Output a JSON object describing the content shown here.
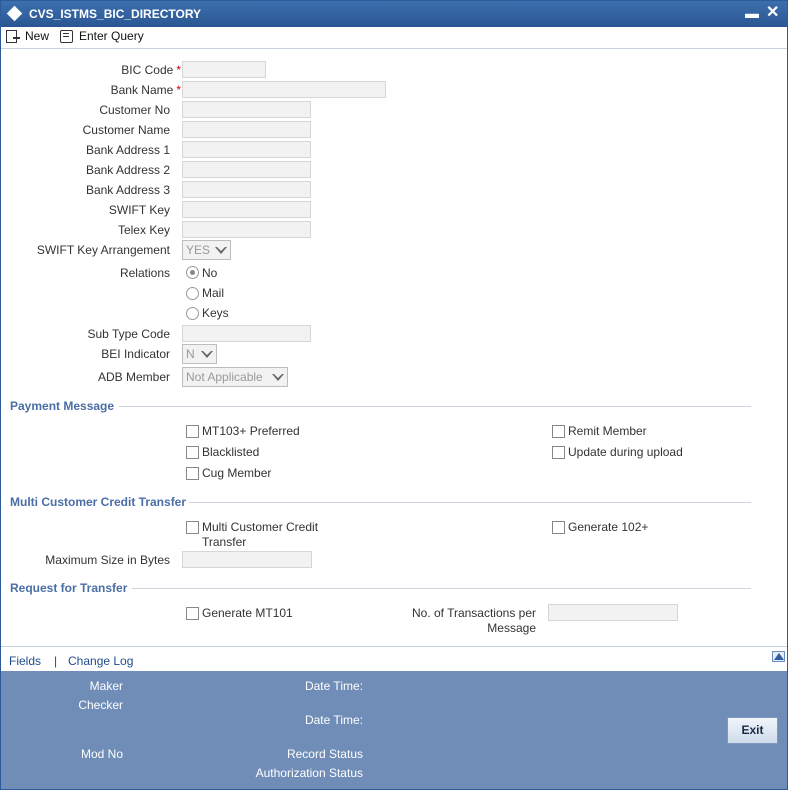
{
  "window": {
    "title": "CVS_ISTMS_BIC_DIRECTORY",
    "minimize": "▬",
    "close": "✕"
  },
  "toolbar": {
    "new_label": "New",
    "enter_query_label": "Enter Query"
  },
  "form": {
    "bic_code": "BIC Code",
    "bank_name": "Bank Name",
    "customer_no": "Customer No",
    "customer_name": "Customer Name",
    "bank_address_1": "Bank Address 1",
    "bank_address_2": "Bank Address 2",
    "bank_address_3": "Bank Address 3",
    "swift_key": "SWIFT Key",
    "telex_key": "Telex Key",
    "swift_key_arrangement": "SWIFT Key Arrangement",
    "swift_key_arrangement_value": "YES",
    "relations": "Relations",
    "relations_options": [
      "No",
      "Mail",
      "Keys"
    ],
    "relations_selected": "No",
    "sub_type_code": "Sub Type Code",
    "bei_indicator": "BEI Indicator",
    "bei_indicator_value": "N",
    "adb_member": "ADB Member",
    "adb_member_value": "Not Applicable",
    "required_mark": "*"
  },
  "payment_message": {
    "title": "Payment Message",
    "mt103_preferred": "MT103+ Preferred",
    "blacklisted": "Blacklisted",
    "cug_member": "Cug Member",
    "remit_member": "Remit Member",
    "update_during_upload": "Update during upload"
  },
  "multi_customer": {
    "title": "Multi Customer Credit Transfer",
    "mcct_line1": "Multi Customer Credit",
    "mcct_line2": "Transfer",
    "generate_102": "Generate 102+",
    "max_size": "Maximum Size in Bytes"
  },
  "request_transfer": {
    "title": "Request for Transfer",
    "generate_mt101": "Generate MT101",
    "num_tx_line1": "No. of Transactions per",
    "num_tx_line2": "Message"
  },
  "footer": {
    "fields_link": "Fields",
    "separator": "|",
    "change_log_link": "Change Log",
    "maker": "Maker",
    "checker": "Checker",
    "date_time": "Date Time:",
    "mod_no": "Mod No",
    "record_status": "Record Status",
    "authorization_status": "Authorization Status",
    "exit_label": "Exit"
  }
}
